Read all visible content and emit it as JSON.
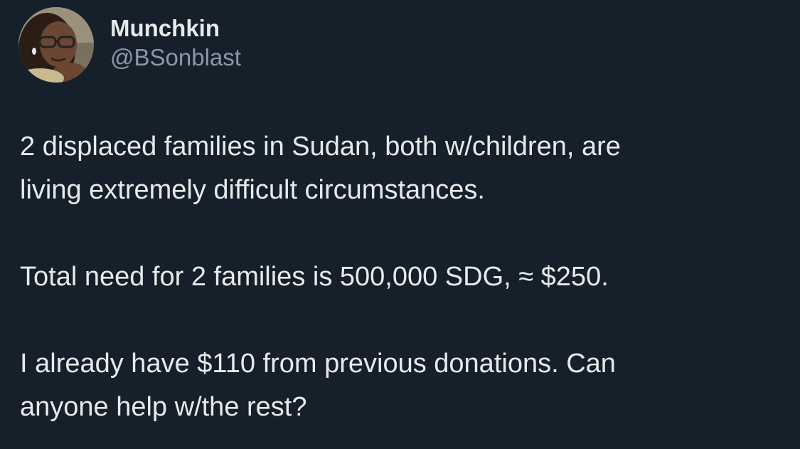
{
  "tweet": {
    "author": {
      "display_name": "Munchkin",
      "handle": "@BSonblast",
      "avatar_icon": "user-avatar-photo"
    },
    "paragraphs": [
      [
        "2 displaced families in Sudan, both w/children, are",
        "living extremely difficult circumstances."
      ],
      [
        "Total need for 2 families is 500,000 SDG, ≈ $250."
      ],
      [
        "I already have $110 from previous donations. Can",
        "anyone help w/the rest?"
      ]
    ]
  },
  "colors": {
    "background": "#15202b",
    "primary_text": "#e7e9ea",
    "secondary_text": "#8b98a5"
  }
}
